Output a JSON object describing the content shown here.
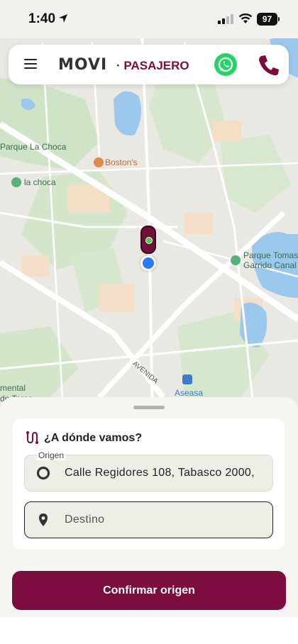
{
  "status_bar": {
    "time": "1:40",
    "battery": "97"
  },
  "header": {
    "logo_text": "MOVI",
    "subtitle": "· PASAJERO"
  },
  "map": {
    "labels": {
      "parque_la_choca": "Parque La Choca",
      "bostons": "Boston's",
      "la_choca": "la choca",
      "parque_tomas_1": "Parque Tomas",
      "parque_tomas_2": "Garrido Canal",
      "avenida": "AVENIDA",
      "aseasa": "Aseasa",
      "mental_1": "mental",
      "mental_2": "de Toros"
    }
  },
  "sheet": {
    "question": "¿A dónde vamos?",
    "origin_label": "Origen",
    "origin_value": "Calle Regidores 108, Tabasco 2000,",
    "destination_placeholder": "Destino",
    "confirm_label": "Confirmar origen"
  },
  "colors": {
    "brand": "#7a0d3d",
    "whatsapp": "#25d366",
    "location_blue": "#2979ff"
  }
}
